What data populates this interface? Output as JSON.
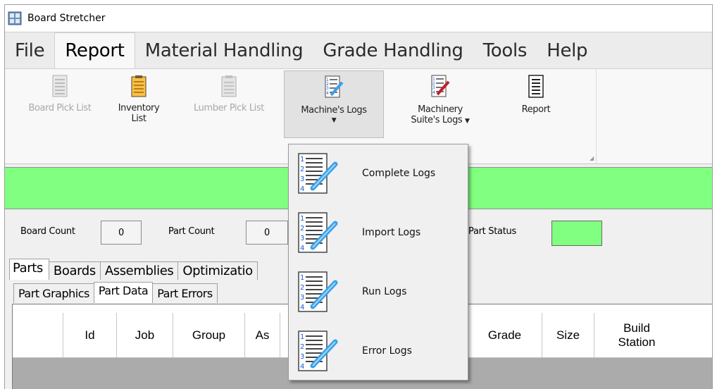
{
  "window": {
    "title": "Board Stretcher",
    "accent": "#80ff80"
  },
  "menu": [
    "File",
    "Report",
    "Material Handling",
    "Grade Handling",
    "Tools",
    "Help"
  ],
  "menu_active": "Report",
  "ribbon": {
    "board_pick_list": "Board Pick List",
    "inventory_list_1": "Inventory",
    "inventory_list_2": "List",
    "lumber_pick_list": "Lumber Pick List",
    "machines_logs": "Machine's Logs",
    "machinery_suite_1": "Machinery",
    "machinery_suite_2": "Suite's Logs",
    "report": "Report",
    "arrow": "▼"
  },
  "counts": {
    "board_count_label": "Board Count",
    "board_count_value": "0",
    "part_count_label": "Part Count",
    "part_count_value": "0",
    "part_status_label": "Part Status"
  },
  "tabs": [
    "Parts",
    "Boards",
    "Assemblies",
    "Optimizatio"
  ],
  "subtabs": [
    "Part Graphics",
    "Part Data",
    "Part Errors"
  ],
  "grid_columns": [
    "",
    "Id",
    "Job",
    "Group",
    "As",
    "",
    "Grade",
    "Size",
    "Build Station"
  ],
  "dropdown": [
    "Complete Logs",
    "Import Logs",
    "Run Logs",
    "Error Logs"
  ]
}
